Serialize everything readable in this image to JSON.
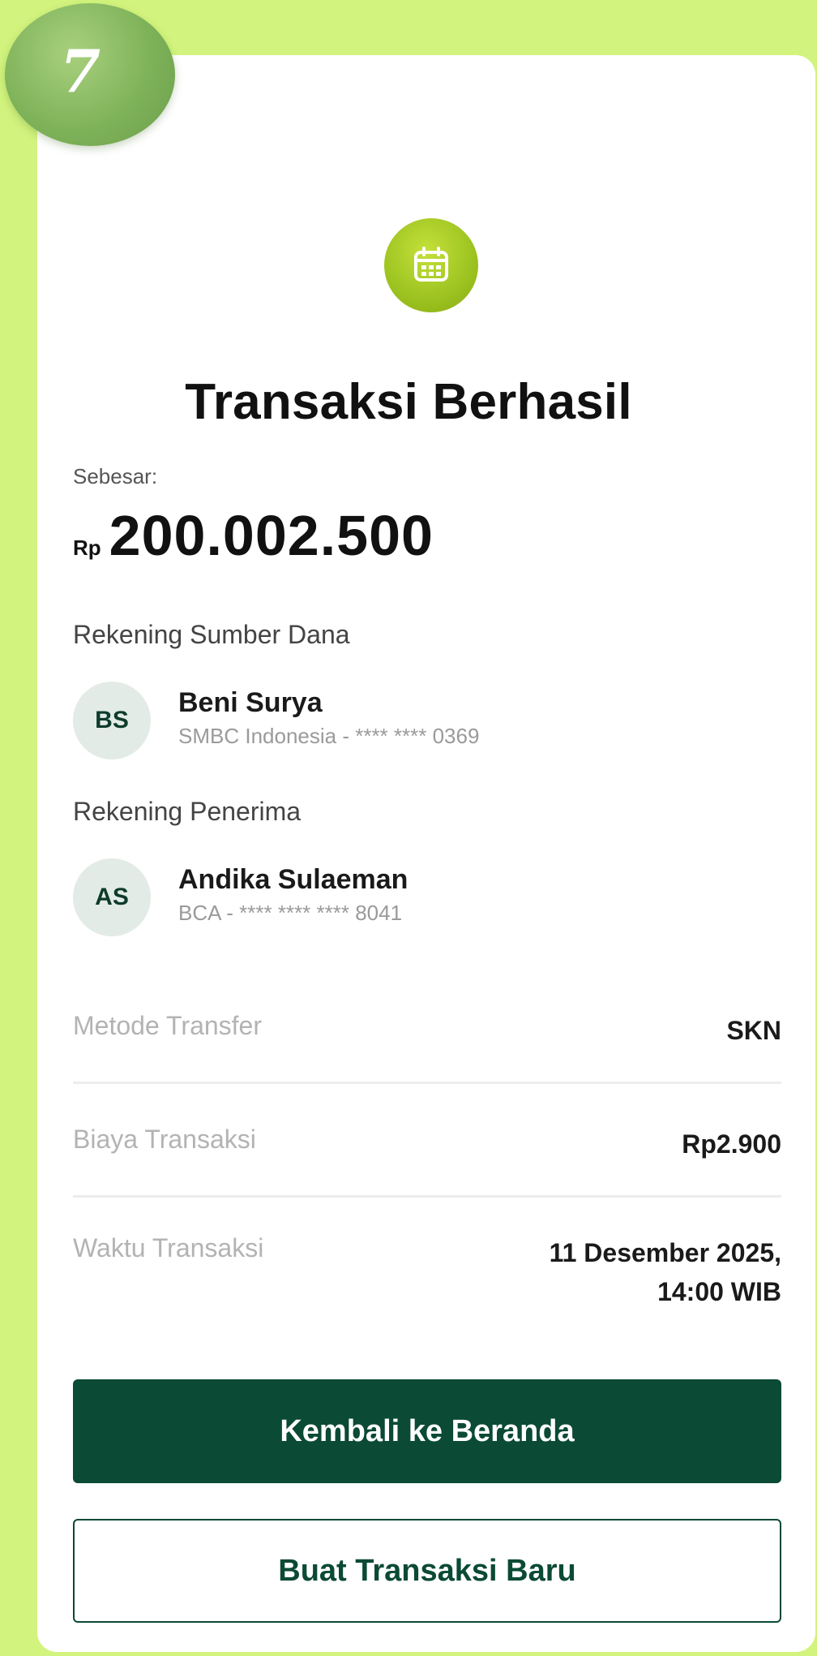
{
  "step_number": "7",
  "header": {
    "icon": "calendar-icon",
    "title": "Transaksi Berhasil"
  },
  "amount": {
    "label": "Sebesar:",
    "currency": "Rp",
    "value": "200.002.500"
  },
  "source": {
    "section_label": "Rekening Sumber Dana",
    "initials": "BS",
    "name": "Beni Surya",
    "account": "SMBC Indonesia - **** **** 0369"
  },
  "recipient": {
    "section_label": "Rekening Penerima",
    "initials": "AS",
    "name": "Andika Sulaeman",
    "account": "BCA - **** **** **** 8041"
  },
  "details": {
    "method_label": "Metode Transfer",
    "method_value": "SKN",
    "fee_label": "Biaya Transaksi",
    "fee_value": "Rp2.900",
    "time_label": "Waktu Transaksi",
    "time_value_line1": "11 Desember 2025,",
    "time_value_line2": "14:00 WIB"
  },
  "actions": {
    "home_label": "Kembali ke Beranda",
    "new_label": "Buat Transaksi Baru"
  },
  "colors": {
    "background": "#d2f47e",
    "primary": "#0b4a35",
    "accent": "#9cc320"
  }
}
